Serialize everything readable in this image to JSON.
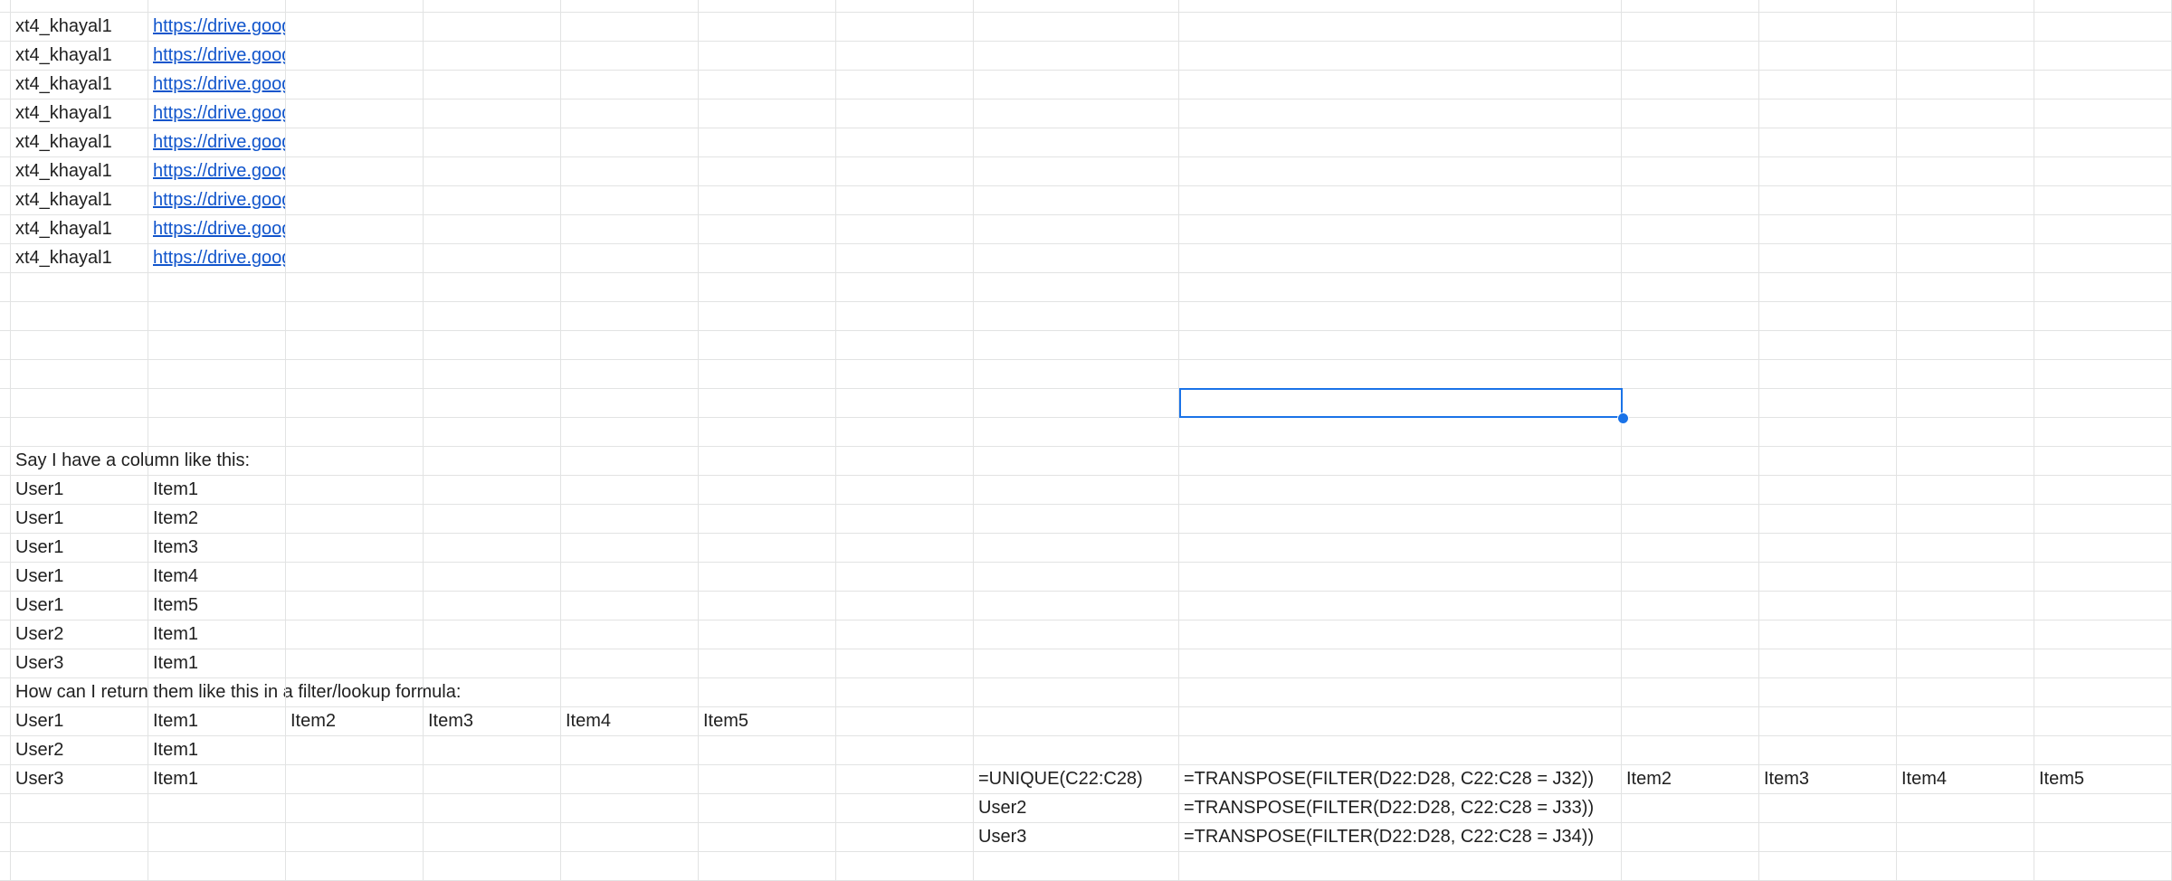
{
  "sheet": {
    "rows": [
      [
        "",
        "",
        "",
        "",
        "",
        "",
        "",
        "",
        "",
        "",
        "",
        "",
        "",
        "",
        ""
      ],
      [
        "",
        "xt4_khayal1",
        "https://drive.google.com",
        "",
        "",
        "",
        "",
        "",
        "",
        "",
        "",
        "",
        "",
        "",
        ""
      ],
      [
        "",
        "xt4_khayal1",
        "https://drive.google.com",
        "",
        "",
        "",
        "",
        "",
        "",
        "",
        "",
        "",
        "",
        "",
        ""
      ],
      [
        "",
        "xt4_khayal1",
        "https://drive.google.com",
        "",
        "",
        "",
        "",
        "",
        "",
        "",
        "",
        "",
        "",
        "",
        ""
      ],
      [
        "",
        "xt4_khayal1",
        "https://drive.google.com",
        "",
        "",
        "",
        "",
        "",
        "",
        "",
        "",
        "",
        "",
        "",
        ""
      ],
      [
        "",
        "xt4_khayal1",
        "https://drive.google.com",
        "",
        "",
        "",
        "",
        "",
        "",
        "",
        "",
        "",
        "",
        "",
        ""
      ],
      [
        "",
        "xt4_khayal1",
        "https://drive.google.com",
        "",
        "",
        "",
        "",
        "",
        "",
        "",
        "",
        "",
        "",
        "",
        ""
      ],
      [
        "",
        "xt4_khayal1",
        "https://drive.google.com",
        "",
        "",
        "",
        "",
        "",
        "",
        "",
        "",
        "",
        "",
        "",
        ""
      ],
      [
        "",
        "xt4_khayal1",
        "https://drive.google.com",
        "",
        "",
        "",
        "",
        "",
        "",
        "",
        "",
        "",
        "",
        "",
        ""
      ],
      [
        "",
        "xt4_khayal1",
        "https://drive.google.com",
        "",
        "",
        "",
        "",
        "",
        "",
        "",
        "",
        "",
        "",
        "",
        ""
      ],
      [
        "",
        "",
        "",
        "",
        "",
        "",
        "",
        "",
        "",
        "",
        "",
        "",
        "",
        "",
        ""
      ],
      [
        "",
        "",
        "",
        "",
        "",
        "",
        "",
        "",
        "",
        "",
        "",
        "",
        "",
        "",
        ""
      ],
      [
        "",
        "",
        "",
        "",
        "",
        "",
        "",
        "",
        "",
        "",
        "",
        "",
        "",
        "",
        ""
      ],
      [
        "",
        "",
        "",
        "",
        "",
        "",
        "",
        "",
        "",
        "",
        "",
        "",
        "",
        "",
        ""
      ],
      [
        "",
        "",
        "",
        "",
        "",
        "",
        "",
        "",
        "",
        "",
        "",
        "",
        "",
        "",
        ""
      ],
      [
        "",
        "",
        "",
        "",
        "",
        "",
        "",
        "",
        "",
        "",
        "",
        "",
        "",
        "",
        ""
      ],
      [
        "",
        "Say I have a column like this:",
        "",
        "",
        "",
        "",
        "",
        "",
        "",
        "",
        "",
        "",
        "",
        "",
        ""
      ],
      [
        "",
        "User1",
        "Item1",
        "",
        "",
        "",
        "",
        "",
        "",
        "",
        "",
        "",
        "",
        "",
        ""
      ],
      [
        "",
        "User1",
        "Item2",
        "",
        "",
        "",
        "",
        "",
        "",
        "",
        "",
        "",
        "",
        "",
        ""
      ],
      [
        "",
        "User1",
        "Item3",
        "",
        "",
        "",
        "",
        "",
        "",
        "",
        "",
        "",
        "",
        "",
        ""
      ],
      [
        "",
        "User1",
        "Item4",
        "",
        "",
        "",
        "",
        "",
        "",
        "",
        "",
        "",
        "",
        "",
        ""
      ],
      [
        "",
        "User1",
        "Item5",
        "",
        "",
        "",
        "",
        "",
        "",
        "",
        "",
        "",
        "",
        "",
        ""
      ],
      [
        "",
        "User2",
        "Item1",
        "",
        "",
        "",
        "",
        "",
        "",
        "",
        "",
        "",
        "",
        "",
        ""
      ],
      [
        "",
        "User3",
        "Item1",
        "",
        "",
        "",
        "",
        "",
        "",
        "",
        "",
        "",
        "",
        "",
        ""
      ],
      [
        "",
        "How can I return them like this in a filter/lookup formula:",
        "",
        "",
        "",
        "",
        "",
        "",
        "",
        "",
        "",
        "",
        "",
        "",
        ""
      ],
      [
        "",
        "User1",
        "Item1",
        "Item2",
        "Item3",
        "Item4",
        "Item5",
        "",
        "",
        "",
        "",
        "",
        "",
        "",
        ""
      ],
      [
        "",
        "User2",
        "Item1",
        "",
        "",
        "",
        "",
        "",
        "",
        "",
        "",
        "",
        "",
        "",
        ""
      ],
      [
        "",
        "User3",
        "Item1",
        "",
        "",
        "",
        "",
        "",
        "=UNIQUE(C22:C28)",
        "=TRANSPOSE(FILTER(D22:D28, C22:C28 = J32))",
        "Item2",
        "Item3",
        "Item4",
        "Item5",
        ""
      ],
      [
        "",
        "",
        "",
        "",
        "",
        "",
        "",
        "",
        "User2",
        "=TRANSPOSE(FILTER(D22:D28, C22:C28 = J33))",
        "",
        "",
        "",
        "",
        ""
      ],
      [
        "",
        "",
        "",
        "",
        "",
        "",
        "",
        "",
        "User3",
        "=TRANSPOSE(FILTER(D22:D28, C22:C28 = J34))",
        "",
        "",
        "",
        "",
        ""
      ],
      [
        "",
        "",
        "",
        "",
        "",
        "",
        "",
        "",
        "",
        "",
        "",
        "",
        "",
        "",
        ""
      ]
    ],
    "link_color": "#1155cc",
    "selection_color": "#1a73e8"
  }
}
